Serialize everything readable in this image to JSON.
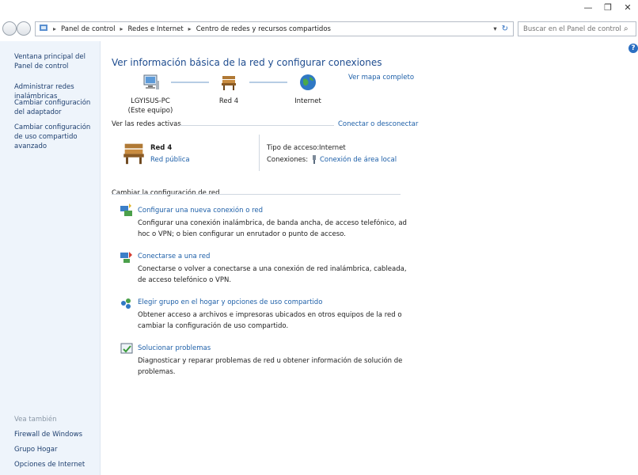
{
  "window": {
    "minimize": "—",
    "restore": "❐",
    "close": "✕"
  },
  "breadcrumb": {
    "items": [
      "Panel de control",
      "Redes e Internet",
      "Centro de redes y recursos compartidos"
    ]
  },
  "search": {
    "placeholder": "Buscar en el Panel de control"
  },
  "sidebar": {
    "items": [
      "Ventana principal del Panel de control",
      "Administrar redes inalámbricas",
      "Cambiar configuración del adaptador",
      "Cambiar configuración de uso compartido avanzado"
    ],
    "see_also_title": "Vea también",
    "see_also": [
      "Firewall de Windows",
      "Grupo Hogar",
      "Opciones de Internet"
    ]
  },
  "main": {
    "title": "Ver información básica de la red y configurar conexiones",
    "full_map": "Ver mapa completo",
    "nodes": {
      "computer": "LGYISUS-PC",
      "computer_sub": "(Este equipo)",
      "network": "Red 4",
      "internet": "Internet"
    },
    "active_title": "Ver las redes activas",
    "connect_link": "Conectar o desconectar",
    "network": {
      "name": "Red 4",
      "type": "Red pública",
      "access_label": "Tipo de acceso:",
      "access_value": "Internet",
      "conn_label": "Conexiones:",
      "conn_value": "Conexión de área local"
    },
    "change_title": "Cambiar la configuración de red",
    "tasks": [
      {
        "title": "Configurar una nueva conexión o red",
        "desc": "Configurar una conexión inalámbrica, de banda ancha, de acceso telefónico, ad hoc o VPN; o bien configurar un enrutador o punto de acceso."
      },
      {
        "title": "Conectarse a una red",
        "desc": "Conectarse o volver a conectarse a una conexión de red inalámbrica, cableada, de acceso telefónico o VPN."
      },
      {
        "title": "Elegir grupo en el hogar y opciones de uso compartido",
        "desc": "Obtener acceso a archivos e impresoras ubicados en otros equipos de la red o cambiar la configuración de uso compartido."
      },
      {
        "title": "Solucionar problemas",
        "desc": "Diagnosticar y reparar problemas de red u obtener información de solución de problemas."
      }
    ]
  },
  "help": "?"
}
